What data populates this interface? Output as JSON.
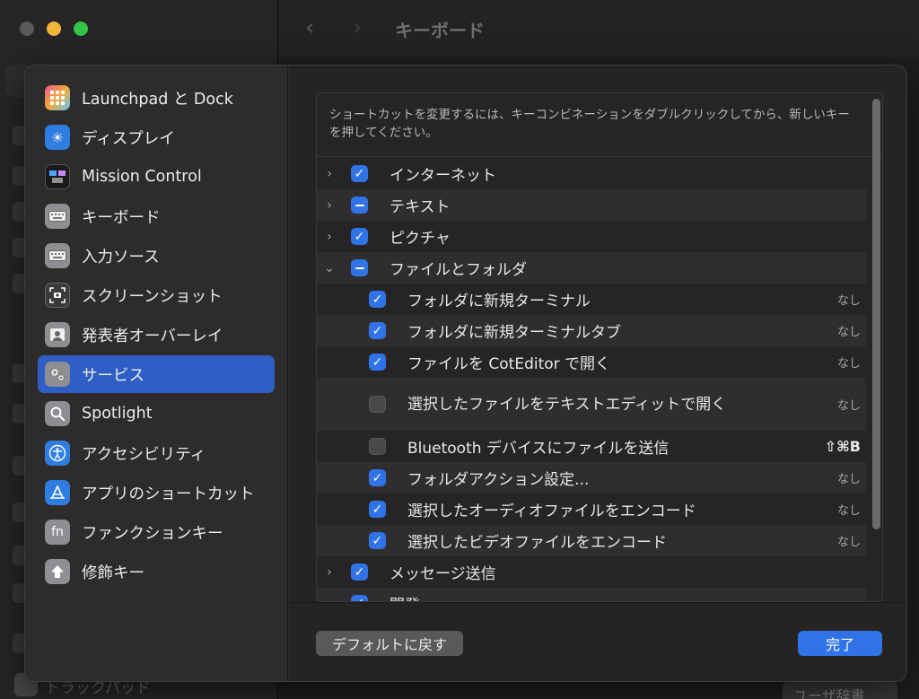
{
  "window": {
    "title": "キーボード",
    "footer_label": "トラックパッド",
    "user_dict_button": "ユーザ辞書..."
  },
  "sidebar": {
    "items": [
      {
        "label": "Launchpad と Dock",
        "icon": "launchpad-icon"
      },
      {
        "label": "ディスプレイ",
        "icon": "display-icon"
      },
      {
        "label": "Mission Control",
        "icon": "mission-control-icon"
      },
      {
        "label": "キーボード",
        "icon": "keyboard-icon"
      },
      {
        "label": "入力ソース",
        "icon": "input-sources-icon"
      },
      {
        "label": "スクリーンショット",
        "icon": "screenshot-icon"
      },
      {
        "label": "発表者オーバーレイ",
        "icon": "presenter-overlay-icon"
      },
      {
        "label": "サービス",
        "icon": "services-icon",
        "selected": true
      },
      {
        "label": "Spotlight",
        "icon": "spotlight-icon"
      },
      {
        "label": "アクセシビリティ",
        "icon": "accessibility-icon"
      },
      {
        "label": "アプリのショートカット",
        "icon": "app-shortcuts-icon"
      },
      {
        "label": "ファンクションキー",
        "icon": "fn-icon"
      },
      {
        "label": "修飾キー",
        "icon": "modifier-keys-icon"
      }
    ]
  },
  "main": {
    "instructions": "ショートカットを変更するには、キーコンビネーションをダブルクリックしてから、新しいキーを押してください。",
    "rows": [
      {
        "label": "インターネット",
        "state": "checked",
        "expanded": false,
        "level": 0
      },
      {
        "label": "テキスト",
        "state": "mixed",
        "expanded": false,
        "level": 0
      },
      {
        "label": "ピクチャ",
        "state": "checked",
        "expanded": false,
        "level": 0
      },
      {
        "label": "ファイルとフォルダ",
        "state": "mixed",
        "expanded": true,
        "level": 0
      },
      {
        "label": "フォルダに新規ターミナル",
        "state": "checked",
        "level": 1,
        "shortcut": "なし"
      },
      {
        "label": "フォルダに新規ターミナルタブ",
        "state": "checked",
        "level": 1,
        "shortcut": "なし"
      },
      {
        "label": "ファイルを CotEditor で開く",
        "state": "checked",
        "level": 1,
        "shortcut": "なし"
      },
      {
        "label": "選択したファイルをテキストエディットで開く",
        "state": "unchecked",
        "level": 1,
        "shortcut": "なし"
      },
      {
        "label": "Bluetooth デバイスにファイルを送信",
        "state": "unchecked",
        "level": 1,
        "shortcut": "⇧⌘B"
      },
      {
        "label": "フォルダアクション設定...",
        "state": "checked",
        "level": 1,
        "shortcut": "なし"
      },
      {
        "label": "選択したオーディオファイルをエンコード",
        "state": "checked",
        "level": 1,
        "shortcut": "なし"
      },
      {
        "label": "選択したビデオファイルをエンコード",
        "state": "checked",
        "level": 1,
        "shortcut": "なし"
      },
      {
        "label": "メッセージ送信",
        "state": "checked",
        "expanded": false,
        "level": 0
      },
      {
        "label": "開発",
        "state": "checked",
        "expanded": false,
        "level": 0
      }
    ]
  },
  "buttons": {
    "restore_defaults": "デフォルトに戻す",
    "done": "完了"
  },
  "colors": {
    "accent": "#2f73e6",
    "selection": "#2f5fc5"
  }
}
